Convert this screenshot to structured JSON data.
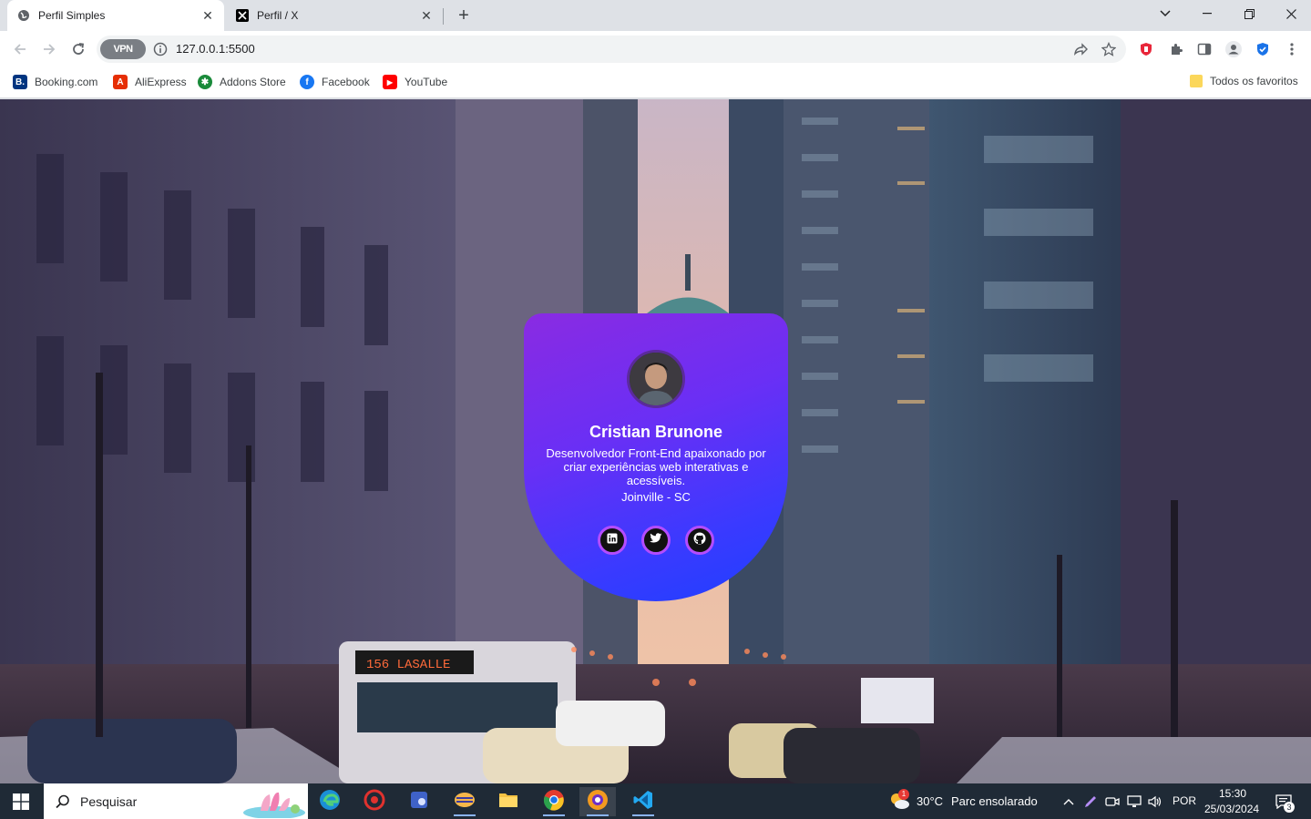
{
  "browser": {
    "tabs": [
      {
        "title": "Perfil Simples",
        "active": true,
        "icon": "globe-icon"
      },
      {
        "title": "Perfil / X",
        "active": false,
        "icon": "x-logo-icon"
      }
    ],
    "new_tab": "+",
    "url": "127.0.0.1:5500",
    "vpn_label": "VPN"
  },
  "bookmarks": {
    "items": [
      {
        "label": "Booking.com",
        "icon": "booking-icon",
        "color": "#003580",
        "glyph": "B."
      },
      {
        "label": "AliExpress",
        "icon": "aliexpress-icon",
        "color": "#e62e04",
        "glyph": "A"
      },
      {
        "label": "Addons Store",
        "icon": "addons-store-icon",
        "color": "#1a8a3a",
        "glyph": "✱"
      },
      {
        "label": "Facebook",
        "icon": "facebook-icon",
        "color": "#1877f2",
        "glyph": "f"
      },
      {
        "label": "YouTube",
        "icon": "youtube-icon",
        "color": "#ff0000",
        "glyph": "▶"
      }
    ],
    "all_bookmarks": "Todos os favoritos"
  },
  "profile": {
    "name": "Cristian Brunone",
    "bio": "Desenvolvedor Front-End apaixonado por criar experiências web interativas e acessíveis.",
    "location": "Joinville - SC",
    "links": [
      {
        "name": "linkedin-icon"
      },
      {
        "name": "twitter-icon"
      },
      {
        "name": "github-icon"
      }
    ]
  },
  "taskbar": {
    "search_placeholder": "Pesquisar",
    "weather_temp": "30°C",
    "weather_desc": "Parc ensolarado",
    "language": "POR",
    "time": "15:30",
    "date": "25/03/2024",
    "notifications_count": "3",
    "weather_badge": "1"
  }
}
